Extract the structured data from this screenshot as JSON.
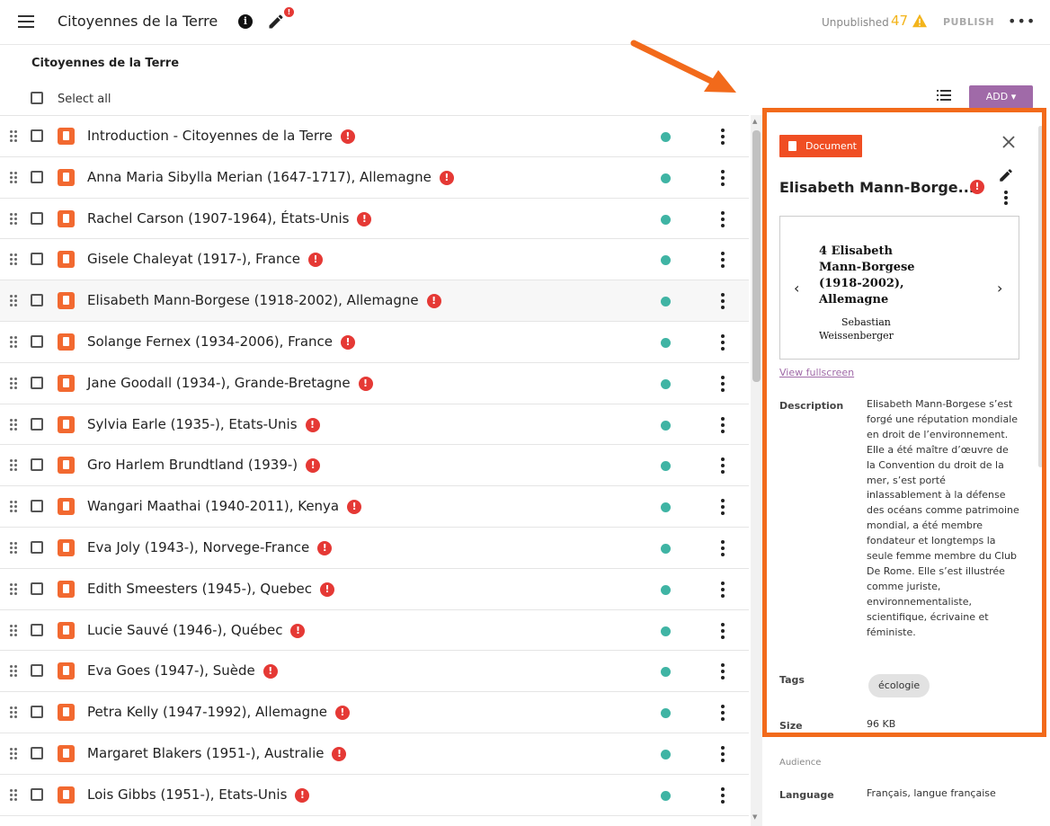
{
  "header": {
    "title": "Citoyennes de la Terre",
    "status": "Unpublished",
    "warning_count": "47",
    "publish_label": "PUBLISH",
    "edit_badge": "!"
  },
  "toolbar": {
    "section_title": "Citoyennes de la Terre",
    "select_all": "Select all",
    "add_label": "ADD ▾"
  },
  "list": {
    "items": [
      {
        "title": "Introduction - Citoyennes de la Terre"
      },
      {
        "title": "Anna Maria Sibylla Merian (1647-1717), Allemagne"
      },
      {
        "title": "Rachel Carson (1907-1964), États-Unis"
      },
      {
        "title": "Gisele Chaleyat (1917-), France"
      },
      {
        "title": "Elisabeth Mann-Borgese (1918-2002), Allemagne"
      },
      {
        "title": "Solange Fernex (1934-2006), France"
      },
      {
        "title": "Jane Goodall (1934-), Grande-Bretagne"
      },
      {
        "title": "Sylvia Earle (1935-), Etats-Unis"
      },
      {
        "title": "Gro Harlem Brundtland (1939-)"
      },
      {
        "title": "Wangari Maathai (1940-2011), Kenya"
      },
      {
        "title": "Eva Joly (1943-), Norvege-France"
      },
      {
        "title": "Edith Smeesters (1945-), Quebec"
      },
      {
        "title": "Lucie Sauvé (1946-), Québec"
      },
      {
        "title": "Eva Goes (1947-), Suède"
      },
      {
        "title": "Petra Kelly (1947-1992), Allemagne"
      },
      {
        "title": "Margaret Blakers (1951-), Australie"
      },
      {
        "title": "Lois Gibbs (1951-), Etats-Unis"
      }
    ],
    "error_glyph": "!"
  },
  "panel": {
    "kind": "Document",
    "title": "Elisabeth Mann-Borge...",
    "preview_title": "4 Elisabeth Mann-Borgese (1918-2002), Allemagne",
    "preview_author_line1": "Sebastian",
    "preview_author_line2": "Weissenberger",
    "prev_glyph": "‹",
    "next_glyph": "›",
    "view_fullscreen": "View fullscreen",
    "description_label": "Description",
    "description": "Elisabeth Mann-Borgese s’est forgé une réputation mondiale en droit de l’environnement. Elle a été maître d’œuvre de la Convention du droit de la mer, s’est porté inlassablement à la défense des océans comme patrimoine mondial, a été membre fondateur et longtemps la seule femme membre du Club De Rome. Elle s’est illustrée comme juriste, environnementaliste, scientifique, écrivaine et féministe.",
    "tags_label": "Tags",
    "tag": "écologie",
    "size_label": "Size",
    "size": "96 KB",
    "audience_label": "Audience",
    "language_label": "Language",
    "language": "Français, langue française"
  },
  "colors": {
    "accent": "#a06aa8",
    "document": "#f04e23",
    "error": "#e53935",
    "published_dot": "#3fb4a4",
    "warning": "#f3b41b",
    "annotation": "#f26a1b"
  }
}
